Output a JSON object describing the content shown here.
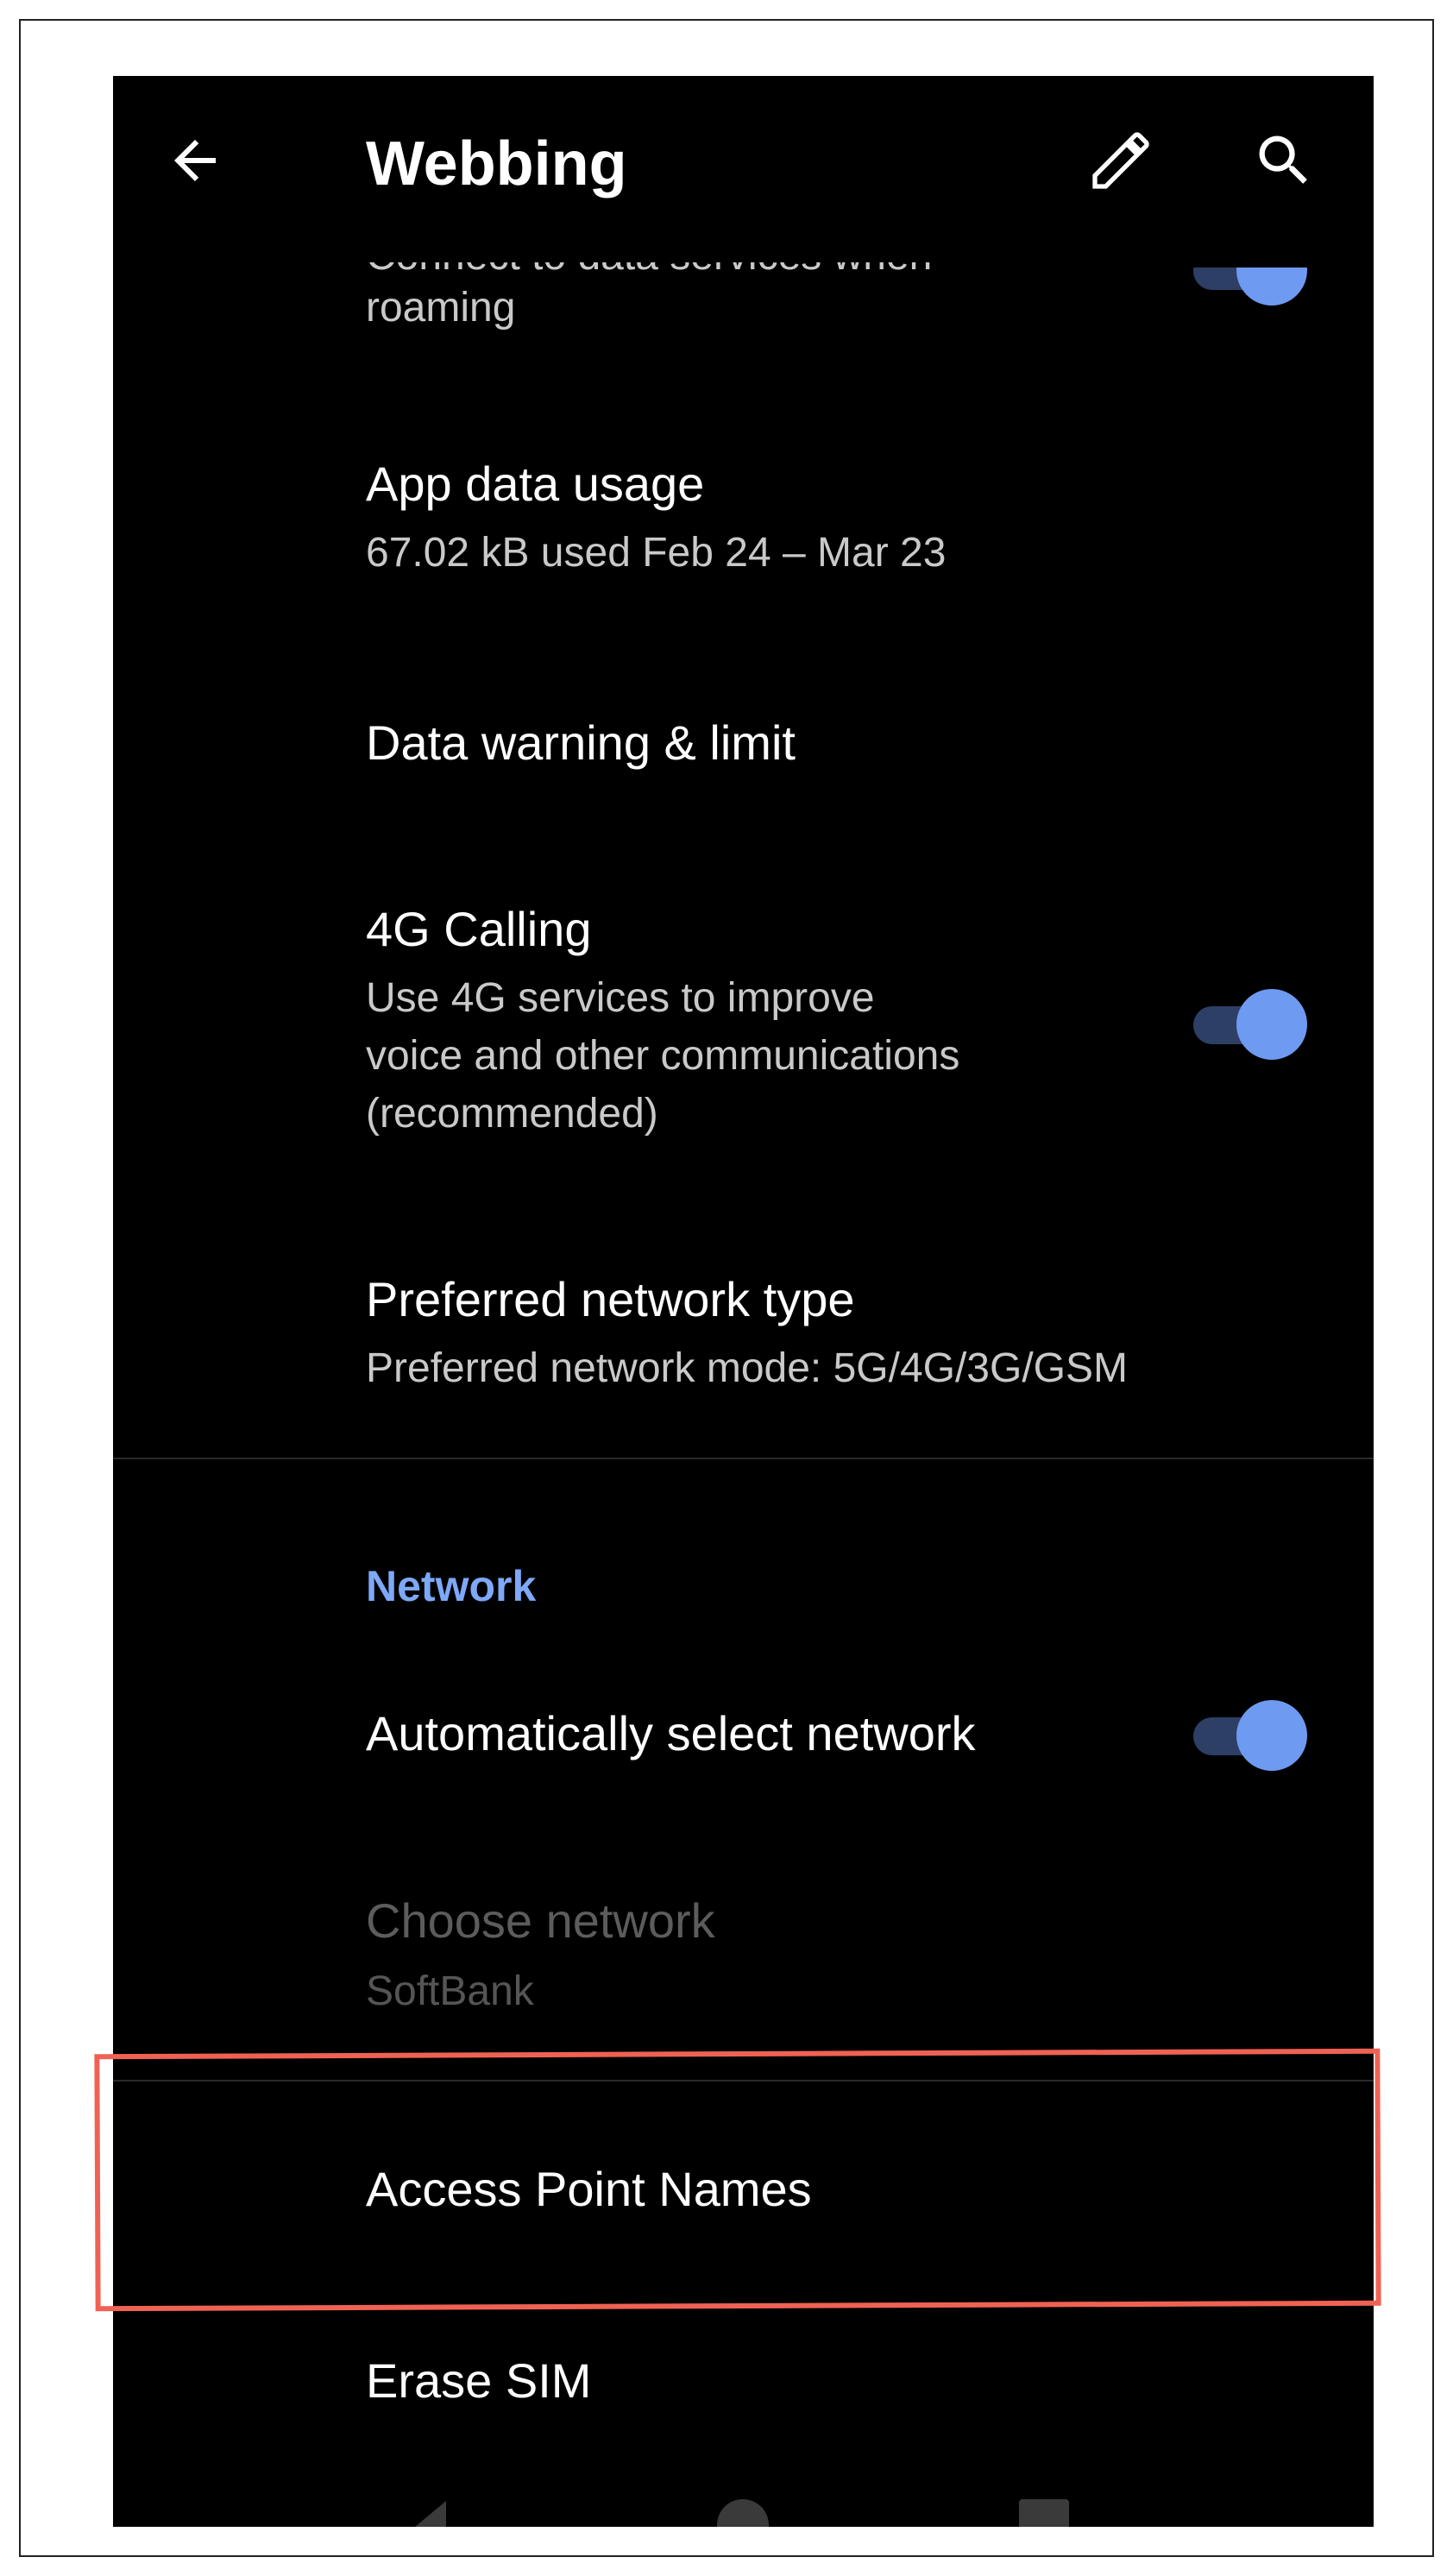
{
  "header": {
    "title": "Webbing",
    "icons": [
      "back-arrow-icon",
      "pencil-icon",
      "search-icon"
    ]
  },
  "roaming": {
    "subtitle_cut": "Connect to data services when",
    "subtitle_line2": "roaming",
    "toggle_on": true
  },
  "app_data_usage": {
    "title": "App data usage",
    "subtitle": "67.02 kB used Feb 24 – Mar 23"
  },
  "data_warning": {
    "title": "Data warning & limit"
  },
  "calling_4g": {
    "title": "4G Calling",
    "subtitle_line1": "Use 4G services to improve",
    "subtitle_line2": "voice and other communications",
    "subtitle_line3": "(recommended)",
    "toggle_on": true
  },
  "preferred_network": {
    "title": "Preferred network type",
    "subtitle": "Preferred network mode: 5G/4G/3G/GSM"
  },
  "network_section": {
    "label": "Network"
  },
  "auto_select": {
    "title": "Automatically select network",
    "toggle_on": true
  },
  "choose_network": {
    "title": "Choose network",
    "subtitle": "SoftBank",
    "disabled": true
  },
  "access_point_names": {
    "title": "Access Point Names",
    "highlighted": true
  },
  "erase_sim": {
    "title": "Erase SIM"
  },
  "colors": {
    "background": "#000000",
    "accent": "#6f9af2",
    "section_label": "#7ea8f8",
    "highlight_border": "#ef6253"
  }
}
